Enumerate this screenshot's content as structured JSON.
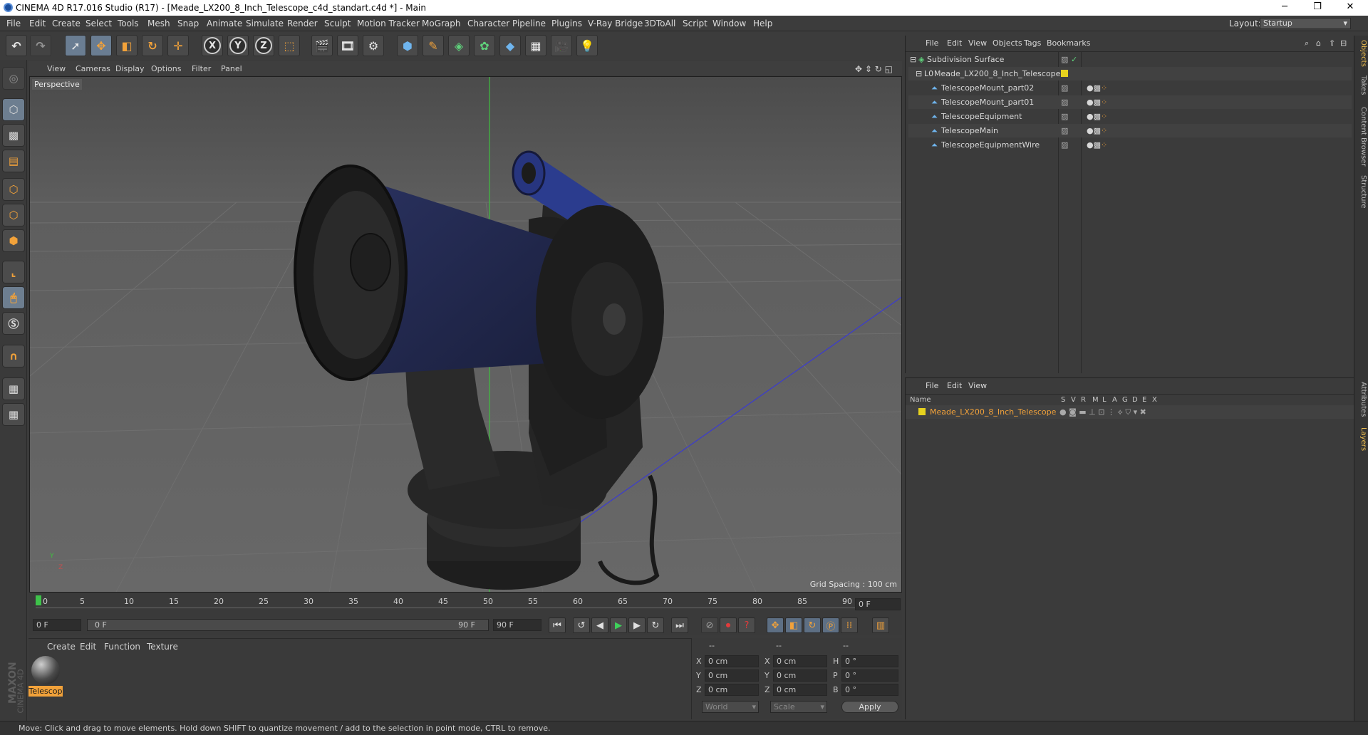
{
  "window": {
    "title": "CINEMA 4D R17.016 Studio (R17) - [Meade_LX200_8_Inch_Telescope_c4d_standart.c4d *] - Main",
    "controls": [
      "─",
      "❐",
      "✕"
    ]
  },
  "menubar": {
    "items": [
      "File",
      "Edit",
      "Create",
      "Select",
      "Tools",
      "Mesh",
      "Snap",
      "Animate",
      "Simulate",
      "Render",
      "Sculpt",
      "Motion Tracker",
      "MoGraph",
      "Character",
      "Pipeline",
      "Plugins",
      "V-Ray Bridge",
      "3DToAll",
      "Script",
      "Window",
      "Help"
    ],
    "layout_label": "Layout:",
    "layout_value": "Startup"
  },
  "toolbar": {
    "axis_x": "X",
    "axis_y": "Y",
    "axis_z": "Z"
  },
  "viewport": {
    "menu": [
      "View",
      "Cameras",
      "Display",
      "Options",
      "Filter",
      "Panel"
    ],
    "label": "Perspective",
    "grid_spacing": "Grid Spacing : 100 cm",
    "axis_y": "Y",
    "axis_z": "Z"
  },
  "timeline": {
    "ticks": [
      "0",
      "5",
      "10",
      "15",
      "20",
      "25",
      "30",
      "35",
      "40",
      "45",
      "50",
      "55",
      "60",
      "65",
      "70",
      "75",
      "80",
      "85",
      "90"
    ],
    "current_frame": "0 F"
  },
  "transport": {
    "start": "0 F",
    "range_start": "0 F",
    "range_end": "90 F",
    "end": "90 F"
  },
  "material_panel": {
    "menu": [
      "Create",
      "Edit",
      "Function",
      "Texture"
    ],
    "material_name": "Telescop",
    "brand_line1": "MAXON",
    "brand_line2": "CINEMA 4D"
  },
  "coord_panel": {
    "headers": [
      "--",
      "--",
      "--"
    ],
    "rows": [
      {
        "a": "X",
        "av": "0 cm",
        "b": "X",
        "bv": "0 cm",
        "c": "H",
        "cv": "0 °"
      },
      {
        "a": "Y",
        "av": "0 cm",
        "b": "Y",
        "bv": "0 cm",
        "c": "P",
        "cv": "0 °"
      },
      {
        "a": "Z",
        "av": "0 cm",
        "b": "Z",
        "bv": "0 cm",
        "c": "B",
        "cv": "0 °"
      }
    ],
    "mode": "World",
    "scale": "Scale",
    "apply": "Apply"
  },
  "objects_panel": {
    "menu": [
      "File",
      "Edit",
      "View",
      "Objects",
      "Tags",
      "Bookmarks"
    ],
    "items": [
      {
        "name": "Subdivision Surface",
        "indent": 0
      },
      {
        "name": "Meade_LX200_8_Inch_Telescope",
        "indent": 1
      },
      {
        "name": "TelescopeMount_part02",
        "indent": 2
      },
      {
        "name": "TelescopeMount_part01",
        "indent": 2
      },
      {
        "name": "TelescopeEquipment",
        "indent": 2
      },
      {
        "name": "TelescopeMain",
        "indent": 2
      },
      {
        "name": "TelescopeEquipmentWire",
        "indent": 2
      }
    ]
  },
  "layers_panel": {
    "menu": [
      "File",
      "Edit",
      "View"
    ],
    "columns": [
      "Name",
      "S",
      "V",
      "R",
      "M",
      "L",
      "A",
      "G",
      "D",
      "E",
      "X"
    ],
    "layer_name": "Meade_LX200_8_Inch_Telescope"
  },
  "right_tabs": [
    "Objects",
    "Takes",
    "Content Browser",
    "Structure",
    "Attributes",
    "Layers"
  ],
  "statusbar": {
    "text": "Move: Click and drag to move elements. Hold down SHIFT to quantize movement / add to the selection in point mode, CTRL to remove."
  },
  "colors": {
    "accent": "#f2a23a",
    "layer_color": "#e6d21e",
    "selection": "#6d7e90"
  }
}
